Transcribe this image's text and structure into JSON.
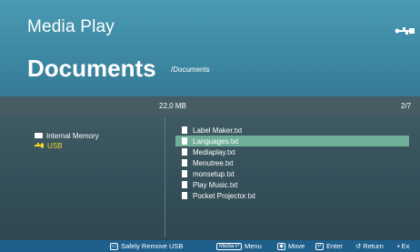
{
  "header": {
    "app_title": "Media Play",
    "page_title": "Documents",
    "path": "/Documents"
  },
  "info_bar": {
    "size": "22,0 MB",
    "page": "2/7"
  },
  "devices": [
    {
      "label": "Internal Memory",
      "icon": "internal-memory-icon",
      "active": false
    },
    {
      "label": "USB",
      "icon": "usb-icon",
      "active": true
    }
  ],
  "files": [
    {
      "name": "Label Maker.txt",
      "selected": false
    },
    {
      "name": "Languages.txt",
      "selected": true
    },
    {
      "name": "Mediaplay.txt",
      "selected": false
    },
    {
      "name": "Menutree.txt",
      "selected": false
    },
    {
      "name": "monsetup.txt",
      "selected": false
    },
    {
      "name": "Play Music.txt",
      "selected": false
    },
    {
      "name": "Pocket Projector.txt",
      "selected": false
    }
  ],
  "bottom_bar": {
    "safely_remove": "Safely Remove USB",
    "media_key": "Media P",
    "menu": "Menu",
    "move": "Move",
    "enter": "Enter",
    "return": "Return",
    "exit": "Ex"
  },
  "colors": {
    "header": "#3d89a3",
    "panel": "#35505a",
    "selection": "#6fae97",
    "usb_accent": "#f2d72a",
    "bottom_bar": "#1f5f8c"
  }
}
